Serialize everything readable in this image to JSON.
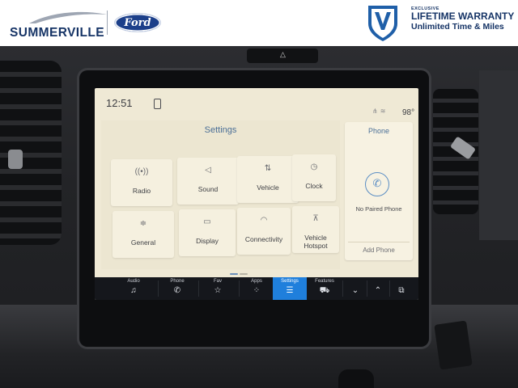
{
  "banner": {
    "dealer_name": "SUMMERVILLE",
    "brand": "Ford",
    "warranty_small": "EXCLUSIVE",
    "warranty_title": "LIFETIME WARRANTY",
    "warranty_sub": "Unlimited Time & Miles"
  },
  "screen": {
    "time": "12:51",
    "temperature": "98°",
    "main_title": "Settings",
    "tiles": [
      {
        "label": "Radio",
        "icon": "radio-icon"
      },
      {
        "label": "Sound",
        "icon": "speaker-icon"
      },
      {
        "label": "Vehicle",
        "icon": "vehicle-icon"
      },
      {
        "label": "Clock",
        "icon": "clock-icon"
      },
      {
        "label": "General",
        "icon": "sliders-icon"
      },
      {
        "label": "Display",
        "icon": "display-icon"
      },
      {
        "label": "Connectivity",
        "icon": "wifi-icon"
      },
      {
        "label": "Vehicle Hotspot",
        "icon": "hotspot-icon"
      }
    ],
    "phone": {
      "title": "Phone",
      "status": "No Paired Phone",
      "add_label": "Add Phone"
    }
  },
  "nav": [
    {
      "label": "Audio",
      "icon": "music-note-icon"
    },
    {
      "label": "Phone",
      "icon": "phone-icon"
    },
    {
      "label": "Fav",
      "icon": "star-icon"
    },
    {
      "label": "Apps",
      "icon": "apps-grid-icon"
    },
    {
      "label": "Settings",
      "icon": "settings-sliders-icon"
    },
    {
      "label": "Features",
      "icon": "car-icon"
    },
    {
      "label": "",
      "icon": "chevron-down-icon"
    },
    {
      "label": "",
      "icon": "chevron-up-icon"
    },
    {
      "label": "",
      "icon": "windows-icon"
    }
  ],
  "colors": {
    "accent": "#1f7fdc",
    "screen_bg": "#efe9d5",
    "title_blue": "#4b6f97",
    "banner_navy": "#163466"
  }
}
